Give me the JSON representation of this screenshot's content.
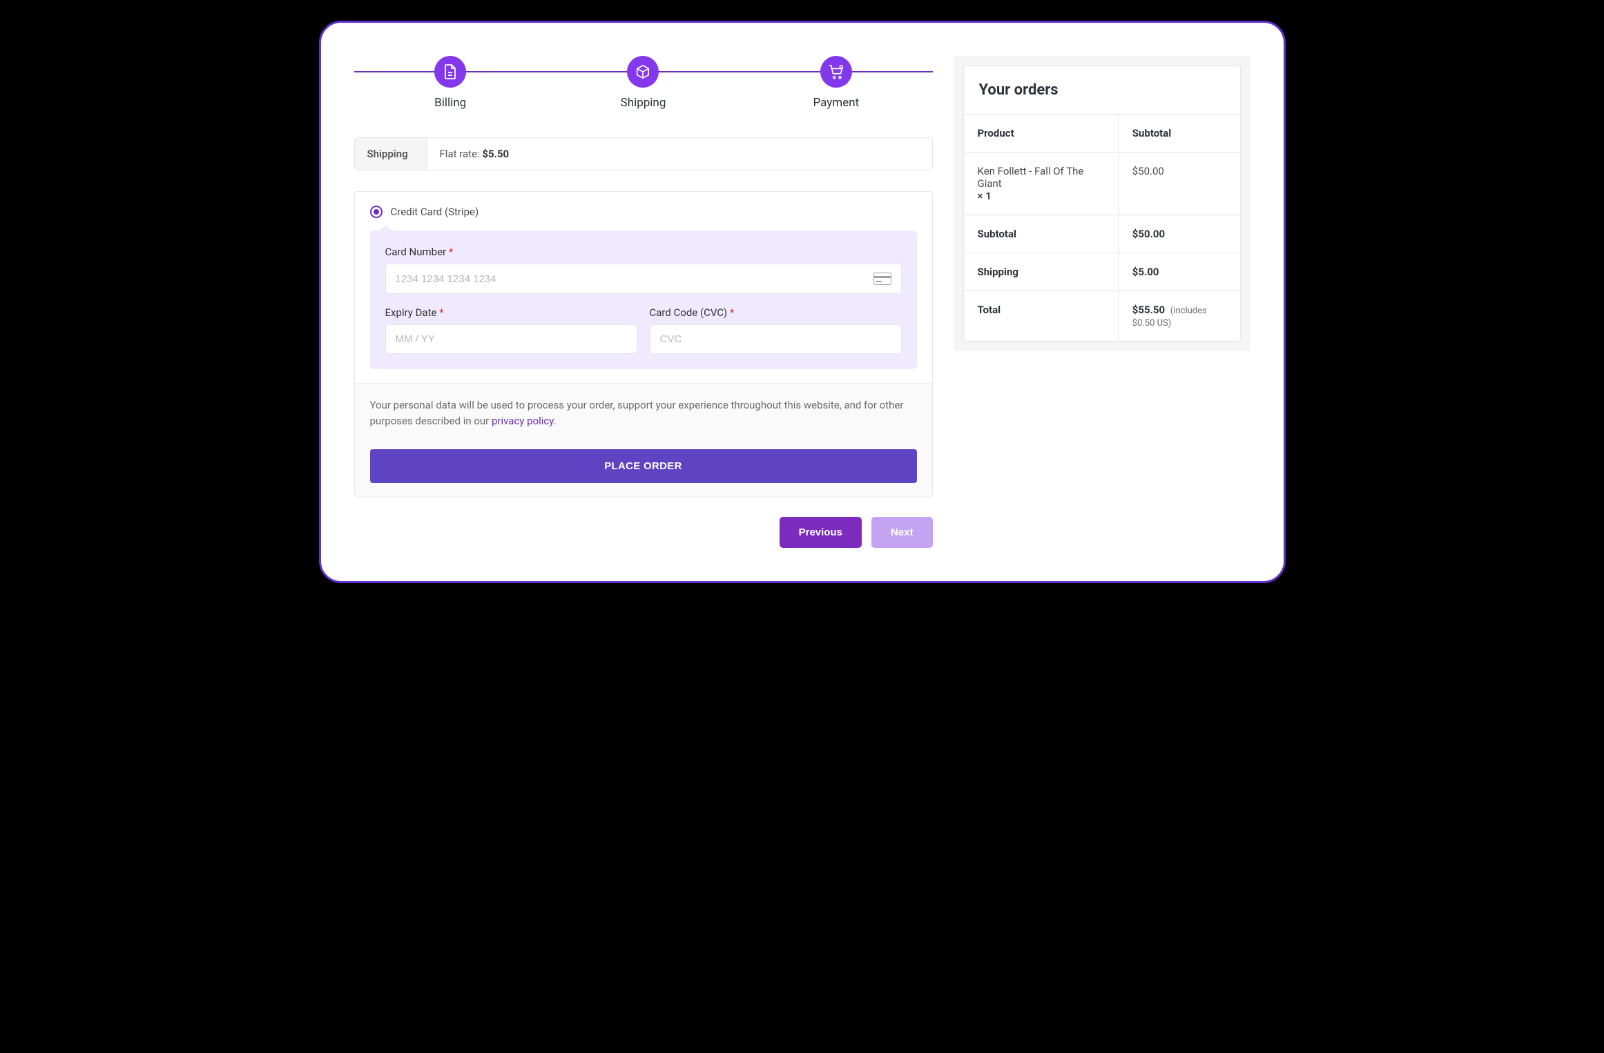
{
  "stepper": {
    "steps": [
      {
        "label": "Billing"
      },
      {
        "label": "Shipping"
      },
      {
        "label": "Payment"
      }
    ]
  },
  "shipping_bar": {
    "label": "Shipping",
    "rate_prefix": "Flat rate: ",
    "rate_value": "$5.50"
  },
  "payment": {
    "method_label": "Credit Card (Stripe)",
    "card_number_label": "Card Number",
    "card_number_placeholder": "1234 1234 1234 1234",
    "expiry_label": "Expiry Date",
    "expiry_placeholder": "MM / YY",
    "cvc_label": "Card Code (CVC)",
    "cvc_placeholder": "CVC",
    "required_mark": "*"
  },
  "privacy": {
    "text_before": "Your personal data will be used to process your order, support your experience throughout this website, and for other purposes described in our ",
    "link_text": "privacy policy",
    "text_after": "."
  },
  "buttons": {
    "place_order": "PLACE ORDER",
    "previous": "Previous",
    "next": "Next"
  },
  "orders": {
    "title": "Your orders",
    "header_product": "Product",
    "header_subtotal": "Subtotal",
    "item_name": "Ken Follett - Fall Of The Giant",
    "item_qty": "× 1",
    "item_price": "$50.00",
    "subtotal_label": "Subtotal",
    "subtotal_value": "$50.00",
    "shipping_label": "Shipping",
    "shipping_value": "$5.00",
    "total_label": "Total",
    "total_value": "$55.50",
    "total_note": "(includes $0.50 US)"
  }
}
